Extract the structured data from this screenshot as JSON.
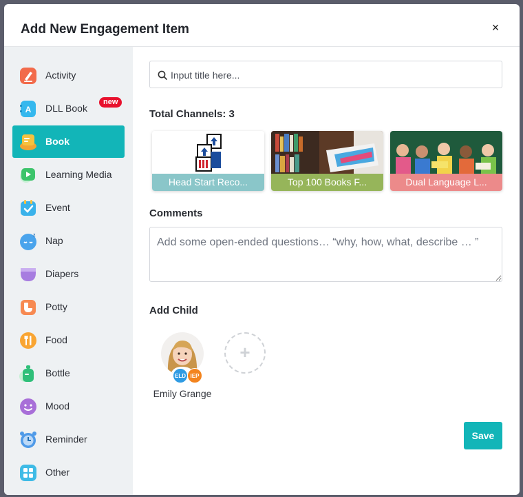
{
  "modal": {
    "title": "Add New Engagement Item"
  },
  "sidebar": {
    "items": [
      {
        "label": "Activity",
        "icon": "activity-icon",
        "color": "#f26b4b"
      },
      {
        "label": "DLL Book",
        "icon": "dll-book-icon",
        "color": "#35b8ee",
        "badge": "new"
      },
      {
        "label": "Book",
        "icon": "book-icon",
        "color": "#f7c23e",
        "active": true
      },
      {
        "label": "Learning Media",
        "icon": "learning-media-icon",
        "color": "#3cc46b"
      },
      {
        "label": "Event",
        "icon": "event-icon",
        "color": "#3ab2ea"
      },
      {
        "label": "Nap",
        "icon": "nap-icon",
        "color": "#4aa4ec"
      },
      {
        "label": "Diapers",
        "icon": "diapers-icon",
        "color": "#a77de0"
      },
      {
        "label": "Potty",
        "icon": "potty-icon",
        "color": "#f78a52"
      },
      {
        "label": "Food",
        "icon": "food-icon",
        "color": "#f9a532"
      },
      {
        "label": "Bottle",
        "icon": "bottle-icon",
        "color": "#2fbf79"
      },
      {
        "label": "Mood",
        "icon": "mood-icon",
        "color": "#a86fd8"
      },
      {
        "label": "Reminder",
        "icon": "reminder-icon",
        "color": "#4f9ae8"
      },
      {
        "label": "Other",
        "icon": "other-icon",
        "color": "#3ebbe6"
      }
    ]
  },
  "search": {
    "placeholder": "Input title here..."
  },
  "channels": {
    "heading": "Total Channels: 3",
    "items": [
      {
        "caption": "Head Start Reco...",
        "color": "#8ac6c9"
      },
      {
        "caption": "Top 100 Books F...",
        "color": "#96b55a"
      },
      {
        "caption": "Dual Language L...",
        "color": "#ec8a8a"
      }
    ]
  },
  "comments": {
    "label": "Comments",
    "placeholder": "Add some open-ended questions… “why, how, what, describe … ”"
  },
  "add_child": {
    "label": "Add Child",
    "children": [
      {
        "name": "Emily Grange",
        "tags": [
          "ELD",
          "IEP"
        ]
      }
    ],
    "add_symbol": "+"
  },
  "actions": {
    "save_label": "Save",
    "close_symbol": "×"
  },
  "colors": {
    "accent": "#12b5b8",
    "badge": "#e8112d",
    "eld": "#2f9be3",
    "iep": "#f3841e"
  }
}
